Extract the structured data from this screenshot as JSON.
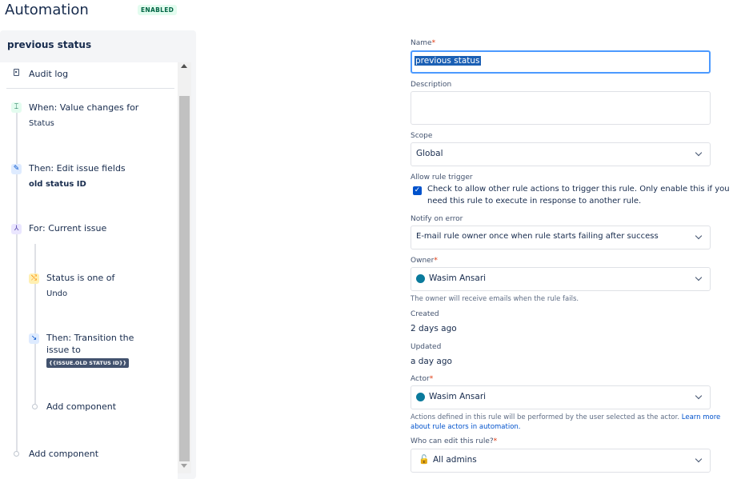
{
  "header": {
    "title": "Automation",
    "status_badge": "ENABLED"
  },
  "rule_panel": {
    "title": "previous status",
    "audit_log": "Audit log",
    "steps": {
      "trigger": {
        "title": "When: Value changes for",
        "detail": "Status"
      },
      "edit": {
        "title": "Then: Edit issue fields",
        "detail": "old status ID"
      },
      "branch": {
        "title": "For: Current issue"
      },
      "condition": {
        "title": "Status is one of",
        "detail": "Undo"
      },
      "transition": {
        "title_line1": "Then: Transition the",
        "title_line2": "issue to",
        "tag": "{{ISSUE.OLD STATUS ID}}"
      },
      "add_inner": "Add component",
      "add_outer": "Add component"
    }
  },
  "form": {
    "name": {
      "label": "Name",
      "value": "previous status"
    },
    "description": {
      "label": "Description",
      "value": ""
    },
    "scope": {
      "label": "Scope",
      "value": "Global"
    },
    "allow_trigger": {
      "label": "Allow rule trigger",
      "checked": true,
      "text_line1": "Check to allow other rule actions to trigger this rule. Only enable this if you",
      "text_line2": "need this rule to execute in response to another rule."
    },
    "notify": {
      "label": "Notify on error",
      "value": "E-mail rule owner once when rule starts failing after success"
    },
    "owner": {
      "label": "Owner",
      "value": "Wasim Ansari",
      "help": "The owner will receive emails when the rule fails."
    },
    "created": {
      "label": "Created",
      "value": "2 days ago"
    },
    "updated": {
      "label": "Updated",
      "value": "a day ago"
    },
    "actor": {
      "label": "Actor",
      "value": "Wasim Ansari",
      "help_text": "Actions defined in this rule will be performed by the user selected as the actor.",
      "help_link_part1": "Learn more",
      "help_link_part2": "about rule actors in automation."
    },
    "edit_permission": {
      "label": "Who can edit this rule?",
      "value": "All admins"
    }
  },
  "colors": {
    "badge_bg": "#e3fcef",
    "badge_text": "#006644",
    "link": "#0052cc",
    "required": "#de350b",
    "focus_border": "#4c9aff"
  }
}
